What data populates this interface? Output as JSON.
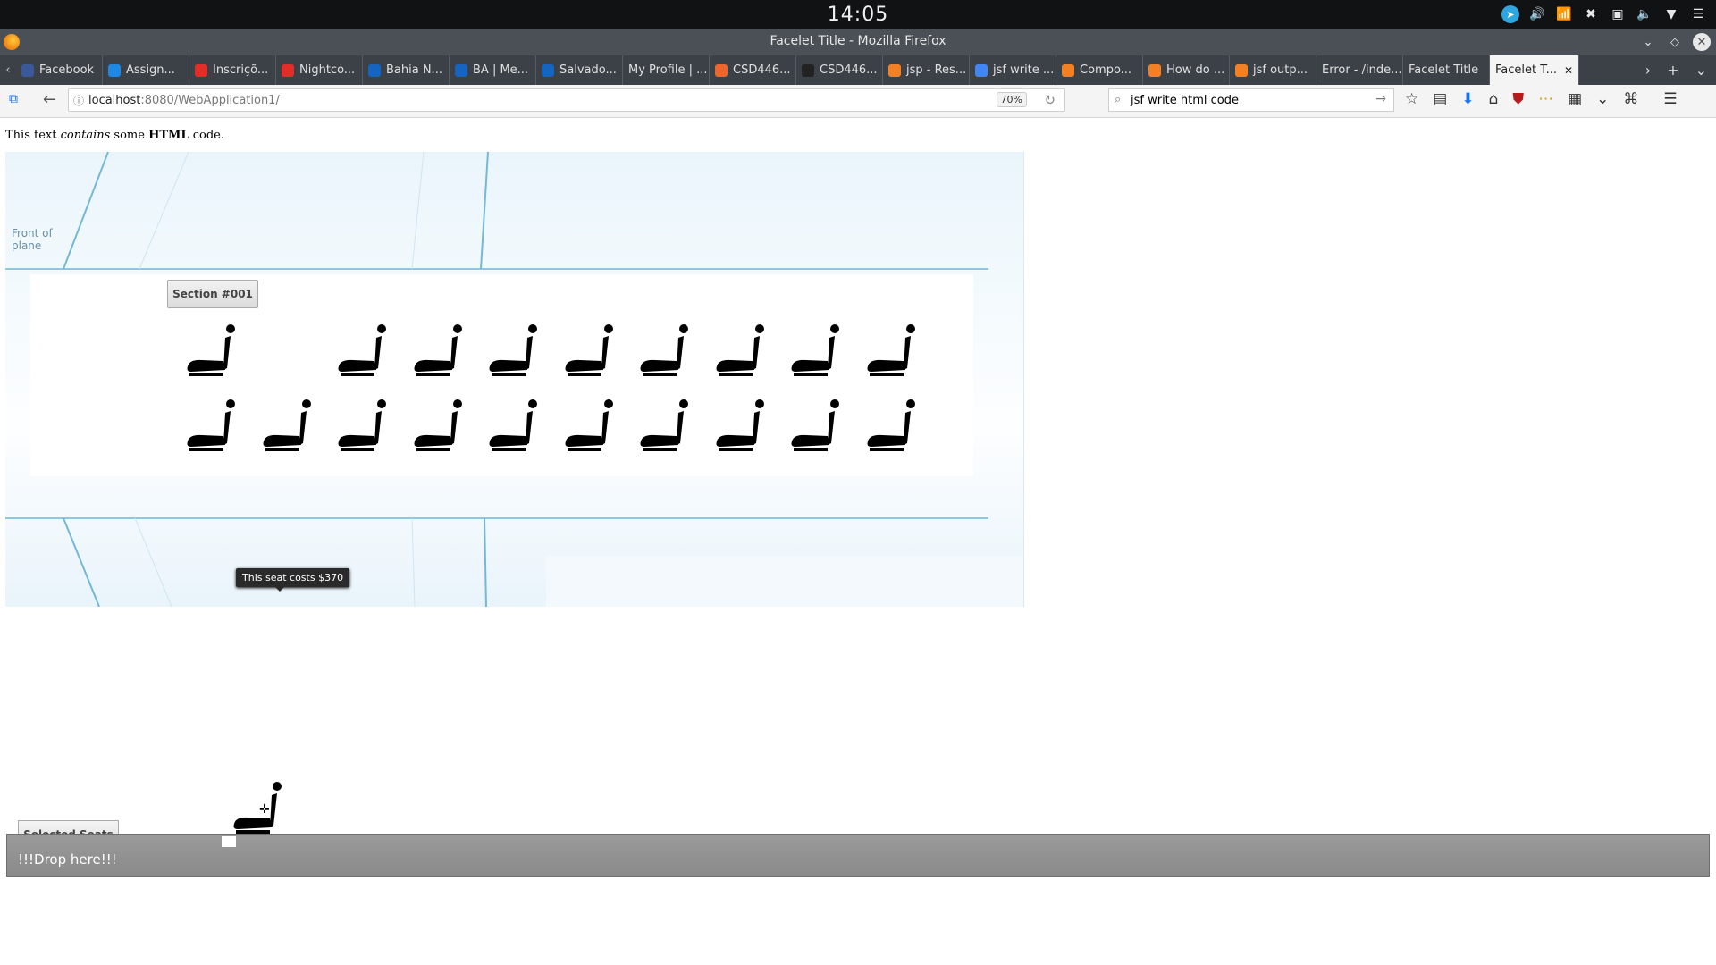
{
  "system": {
    "clock": "14:05"
  },
  "window": {
    "title": "Facelet Title - Mozilla Firefox"
  },
  "tabs": [
    {
      "label": "Facebook",
      "color": "#3b5998",
      "icon": "facebook-icon"
    },
    {
      "label": "Assign...",
      "color": "#1e88e5",
      "icon": "dropbox-icon"
    },
    {
      "label": "Inscriçõ...",
      "color": "#e52d27",
      "icon": "youtube-icon"
    },
    {
      "label": "Nightco...",
      "color": "#e52d27",
      "icon": "youtube-icon"
    },
    {
      "label": "Bahia N...",
      "color": "#1565c0",
      "icon": "site-icon"
    },
    {
      "label": "BA | Me...",
      "color": "#1565c0",
      "icon": "site-icon"
    },
    {
      "label": "Salvado...",
      "color": "#1565c0",
      "icon": "site-icon"
    },
    {
      "label": "My Profile | ...",
      "color": "",
      "icon": ""
    },
    {
      "label": "CSD446...",
      "color": "#f0642d",
      "icon": "grid-icon"
    },
    {
      "label": "CSD446...",
      "color": "#222",
      "icon": "github-icon"
    },
    {
      "label": "jsp - Res...",
      "color": "#f48024",
      "icon": "stackoverflow-icon"
    },
    {
      "label": "jsf write ...",
      "color": "#4285f4",
      "icon": "google-icon"
    },
    {
      "label": "Compo...",
      "color": "#f48024",
      "icon": "stackoverflow-icon"
    },
    {
      "label": "How do ...",
      "color": "#f48024",
      "icon": "stackoverflow-icon"
    },
    {
      "label": "jsf outp...",
      "color": "#f48024",
      "icon": "stackoverflow-icon"
    },
    {
      "label": "Error - /inde...",
      "color": "",
      "icon": ""
    },
    {
      "label": "Facelet Title",
      "color": "",
      "icon": ""
    }
  ],
  "active_tab": {
    "label": "Facelet T..."
  },
  "navbar": {
    "url_host": "localhost",
    "url_path": ":8080/WebApplication1/",
    "zoom": "70%",
    "search_value": "jsf write html code"
  },
  "page": {
    "intro_pre": "This text ",
    "intro_em": "contains",
    "intro_mid": " some ",
    "intro_strong": "HTML",
    "intro_post": " code.",
    "front_label_1": "Front of",
    "front_label_2": "plane",
    "section_label": "Section #001",
    "tooltip": "This seat costs $370",
    "selected_seats_label": "Selected Seats",
    "drop_label": "!!!Drop here!!!"
  },
  "seats": {
    "row1_present": [
      true,
      false,
      true,
      true,
      true,
      true,
      true,
      true,
      true,
      true
    ],
    "row2_present": [
      true,
      true,
      true,
      true,
      true,
      true,
      true,
      true,
      true,
      true
    ]
  }
}
